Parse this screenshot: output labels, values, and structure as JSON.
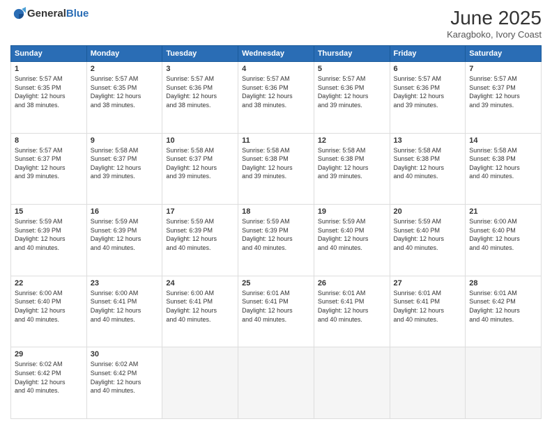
{
  "logo": {
    "general": "General",
    "blue": "Blue"
  },
  "title": "June 2025",
  "subtitle": "Karagboko, Ivory Coast",
  "headers": [
    "Sunday",
    "Monday",
    "Tuesday",
    "Wednesday",
    "Thursday",
    "Friday",
    "Saturday"
  ],
  "weeks": [
    [
      {
        "day": "1",
        "sunrise": "5:57 AM",
        "sunset": "6:35 PM",
        "daylight": "12 hours and 38 minutes."
      },
      {
        "day": "2",
        "sunrise": "5:57 AM",
        "sunset": "6:35 PM",
        "daylight": "12 hours and 38 minutes."
      },
      {
        "day": "3",
        "sunrise": "5:57 AM",
        "sunset": "6:36 PM",
        "daylight": "12 hours and 38 minutes."
      },
      {
        "day": "4",
        "sunrise": "5:57 AM",
        "sunset": "6:36 PM",
        "daylight": "12 hours and 38 minutes."
      },
      {
        "day": "5",
        "sunrise": "5:57 AM",
        "sunset": "6:36 PM",
        "daylight": "12 hours and 39 minutes."
      },
      {
        "day": "6",
        "sunrise": "5:57 AM",
        "sunset": "6:36 PM",
        "daylight": "12 hours and 39 minutes."
      },
      {
        "day": "7",
        "sunrise": "5:57 AM",
        "sunset": "6:37 PM",
        "daylight": "12 hours and 39 minutes."
      }
    ],
    [
      {
        "day": "8",
        "sunrise": "5:57 AM",
        "sunset": "6:37 PM",
        "daylight": "12 hours and 39 minutes."
      },
      {
        "day": "9",
        "sunrise": "5:58 AM",
        "sunset": "6:37 PM",
        "daylight": "12 hours and 39 minutes."
      },
      {
        "day": "10",
        "sunrise": "5:58 AM",
        "sunset": "6:37 PM",
        "daylight": "12 hours and 39 minutes."
      },
      {
        "day": "11",
        "sunrise": "5:58 AM",
        "sunset": "6:38 PM",
        "daylight": "12 hours and 39 minutes."
      },
      {
        "day": "12",
        "sunrise": "5:58 AM",
        "sunset": "6:38 PM",
        "daylight": "12 hours and 39 minutes."
      },
      {
        "day": "13",
        "sunrise": "5:58 AM",
        "sunset": "6:38 PM",
        "daylight": "12 hours and 40 minutes."
      },
      {
        "day": "14",
        "sunrise": "5:58 AM",
        "sunset": "6:38 PM",
        "daylight": "12 hours and 40 minutes."
      }
    ],
    [
      {
        "day": "15",
        "sunrise": "5:59 AM",
        "sunset": "6:39 PM",
        "daylight": "12 hours and 40 minutes."
      },
      {
        "day": "16",
        "sunrise": "5:59 AM",
        "sunset": "6:39 PM",
        "daylight": "12 hours and 40 minutes."
      },
      {
        "day": "17",
        "sunrise": "5:59 AM",
        "sunset": "6:39 PM",
        "daylight": "12 hours and 40 minutes."
      },
      {
        "day": "18",
        "sunrise": "5:59 AM",
        "sunset": "6:39 PM",
        "daylight": "12 hours and 40 minutes."
      },
      {
        "day": "19",
        "sunrise": "5:59 AM",
        "sunset": "6:40 PM",
        "daylight": "12 hours and 40 minutes."
      },
      {
        "day": "20",
        "sunrise": "5:59 AM",
        "sunset": "6:40 PM",
        "daylight": "12 hours and 40 minutes."
      },
      {
        "day": "21",
        "sunrise": "6:00 AM",
        "sunset": "6:40 PM",
        "daylight": "12 hours and 40 minutes."
      }
    ],
    [
      {
        "day": "22",
        "sunrise": "6:00 AM",
        "sunset": "6:40 PM",
        "daylight": "12 hours and 40 minutes."
      },
      {
        "day": "23",
        "sunrise": "6:00 AM",
        "sunset": "6:41 PM",
        "daylight": "12 hours and 40 minutes."
      },
      {
        "day": "24",
        "sunrise": "6:00 AM",
        "sunset": "6:41 PM",
        "daylight": "12 hours and 40 minutes."
      },
      {
        "day": "25",
        "sunrise": "6:01 AM",
        "sunset": "6:41 PM",
        "daylight": "12 hours and 40 minutes."
      },
      {
        "day": "26",
        "sunrise": "6:01 AM",
        "sunset": "6:41 PM",
        "daylight": "12 hours and 40 minutes."
      },
      {
        "day": "27",
        "sunrise": "6:01 AM",
        "sunset": "6:41 PM",
        "daylight": "12 hours and 40 minutes."
      },
      {
        "day": "28",
        "sunrise": "6:01 AM",
        "sunset": "6:42 PM",
        "daylight": "12 hours and 40 minutes."
      }
    ],
    [
      {
        "day": "29",
        "sunrise": "6:02 AM",
        "sunset": "6:42 PM",
        "daylight": "12 hours and 40 minutes."
      },
      {
        "day": "30",
        "sunrise": "6:02 AM",
        "sunset": "6:42 PM",
        "daylight": "12 hours and 40 minutes."
      },
      null,
      null,
      null,
      null,
      null
    ]
  ],
  "labels": {
    "sunrise": "Sunrise:",
    "sunset": "Sunset:",
    "daylight": "Daylight:"
  }
}
